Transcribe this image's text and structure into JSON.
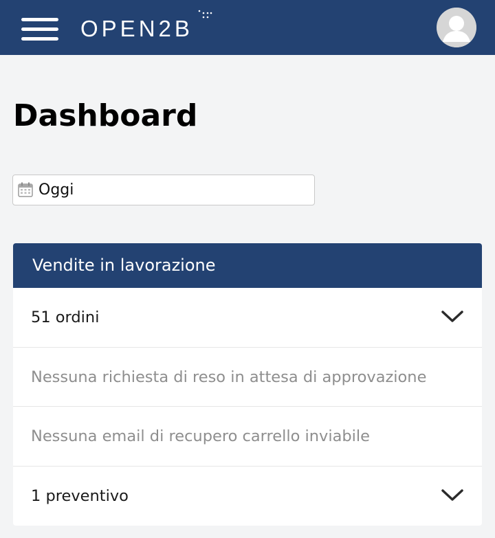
{
  "header": {
    "logo_text": "OPEN2B",
    "menu_icon": "hamburger-menu-icon",
    "avatar_icon": "user-avatar-icon",
    "bg_color": "#234272"
  },
  "page": {
    "title": "Dashboard"
  },
  "date_filter": {
    "icon": "calendar-icon",
    "value": "Oggi"
  },
  "panel": {
    "title": "Vendite in lavorazione",
    "rows": [
      {
        "label": "51 ordini",
        "expandable": true
      },
      {
        "label": "Nessuna richiesta di reso in attesa di approvazione",
        "expandable": false
      },
      {
        "label": "Nessuna email di recupero carrello inviabile",
        "expandable": false
      },
      {
        "label": "1 preventivo",
        "expandable": true
      }
    ]
  }
}
